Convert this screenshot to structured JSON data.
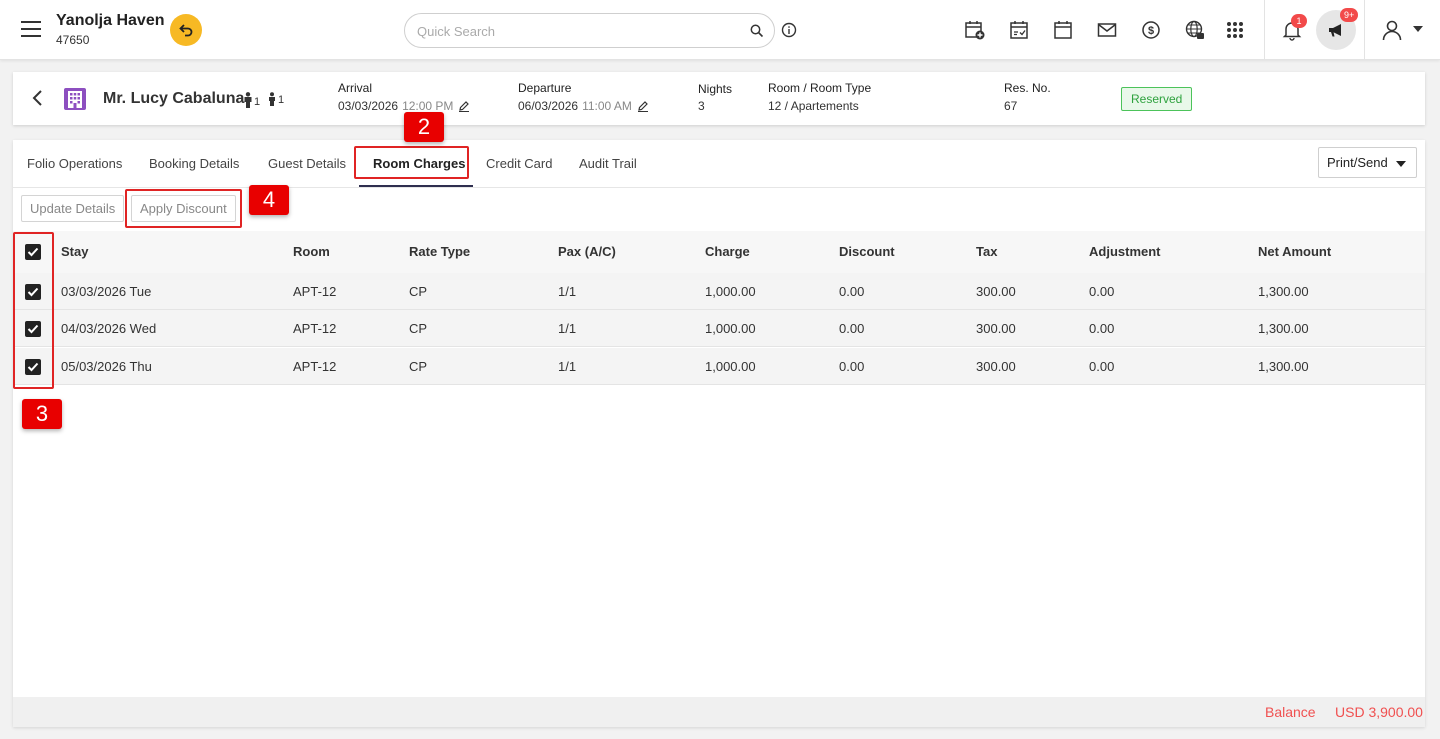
{
  "header": {
    "hotel_name": "Yanolja Haven",
    "hotel_id": "47650",
    "search_placeholder": "Quick Search",
    "notification_count": "1",
    "announcement_count": "9+"
  },
  "reservation": {
    "guest_name": "Mr. Lucy Cabaluna",
    "adults": "1",
    "children": "1",
    "arrival_label": "Arrival",
    "arrival_date": "03/03/2026",
    "arrival_time": "12:00 PM",
    "departure_label": "Departure",
    "departure_date": "06/03/2026",
    "departure_time": "11:00 AM",
    "nights_label": "Nights",
    "nights": "3",
    "room_label": "Room / Room Type",
    "room_value": "12 / Apartements",
    "resno_label": "Res. No.",
    "resno": "67",
    "status": "Reserved"
  },
  "tabs": [
    "Folio Operations",
    "Booking Details",
    "Guest Details",
    "Room Charges",
    "Credit Card",
    "Audit Trail"
  ],
  "print_send": "Print/Send",
  "buttons": {
    "update_details": "Update Details",
    "apply_discount": "Apply Discount"
  },
  "steps": {
    "tab_step": "2",
    "checkbox_step": "3",
    "discount_step": "4"
  },
  "table": {
    "columns": [
      "Stay",
      "Room",
      "Rate Type",
      "Pax (A/C)",
      "Charge",
      "Discount",
      "Tax",
      "Adjustment",
      "Net Amount"
    ],
    "rows": [
      [
        "03/03/2026 Tue",
        "APT-12",
        "CP",
        "1/1",
        "1,000.00",
        "0.00",
        "300.00",
        "0.00",
        "1,300.00"
      ],
      [
        "04/03/2026 Wed",
        "APT-12",
        "CP",
        "1/1",
        "1,000.00",
        "0.00",
        "300.00",
        "0.00",
        "1,300.00"
      ],
      [
        "05/03/2026 Thu",
        "APT-12",
        "CP",
        "1/1",
        "1,000.00",
        "0.00",
        "300.00",
        "0.00",
        "1,300.00"
      ]
    ]
  },
  "footer": {
    "balance_label": "Balance",
    "balance_value": "USD 3,900.00"
  },
  "colors": {
    "accent_yellow": "#f7b924",
    "status_green": "#2ea23e",
    "highlight_red": "#e02424",
    "balance_red": "#f05050"
  }
}
